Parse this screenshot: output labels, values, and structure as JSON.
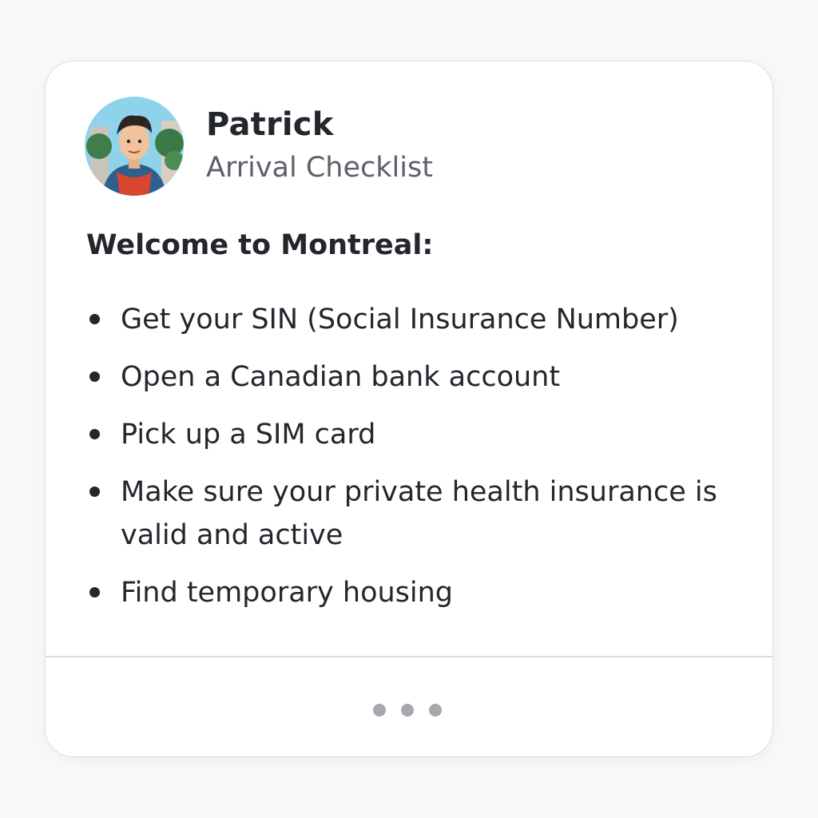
{
  "profile": {
    "name": "Patrick",
    "subtitle": "Arrival Checklist"
  },
  "checklist": {
    "heading": "Welcome to Montreal:",
    "items": [
      {
        "label": "Get your SIN (Social Insurance Number)"
      },
      {
        "label": "Open a Canadian bank account"
      },
      {
        "label": "Pick up a SIM card"
      },
      {
        "label": "Make sure your private health insurance is valid and active"
      },
      {
        "label": "Find temporary housing"
      }
    ]
  },
  "footer": {
    "icon": "more-dots-icon"
  },
  "colors": {
    "card_background": "#ffffff",
    "page_background": "#f8f8f9",
    "text": "#23262c",
    "muted_text": "#5d6068",
    "dots": "#a7a8ad"
  }
}
